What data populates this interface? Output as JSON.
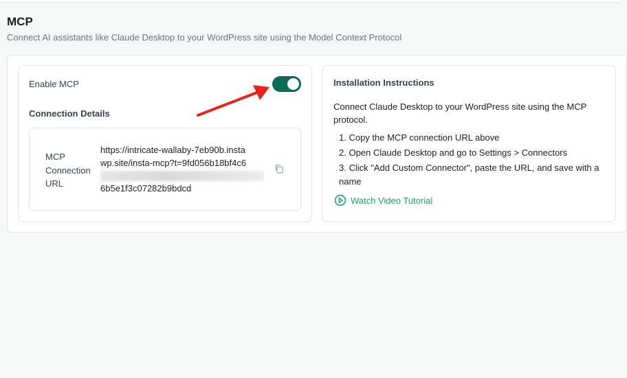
{
  "header": {
    "title": "MCP",
    "subtitle": "Connect AI assistants like Claude Desktop to your WordPress site using the Model Context Protocol"
  },
  "left_card": {
    "enable_label": "Enable MCP",
    "toggle_state": "on",
    "connection_heading": "Connection Details",
    "connection_label": "MCP Connection URL",
    "url_line1": "https://intricate-wallaby-7eb90b.insta",
    "url_line2": "wp.site/insta-mcp?t=9fd056b18bf4c6",
    "url_line3": "6b5e1f3c07282b9bdcd"
  },
  "right_card": {
    "title": "Installation Instructions",
    "description": "Connect Claude Desktop to your WordPress site using the MCP protocol.",
    "steps": [
      "1. Copy the MCP connection URL above",
      "2. Open Claude Desktop and go to Settings > Connectors",
      "3. Click \"Add Custom Connector\", paste the URL, and save with a name"
    ],
    "video_link": "Watch Video Tutorial"
  },
  "colors": {
    "toggle_on": "#0b6b55",
    "link": "#22a06b",
    "annotation_arrow": "#e8231b"
  },
  "icons": [
    "copy-icon",
    "play-circle-icon",
    "annotation-arrow"
  ]
}
